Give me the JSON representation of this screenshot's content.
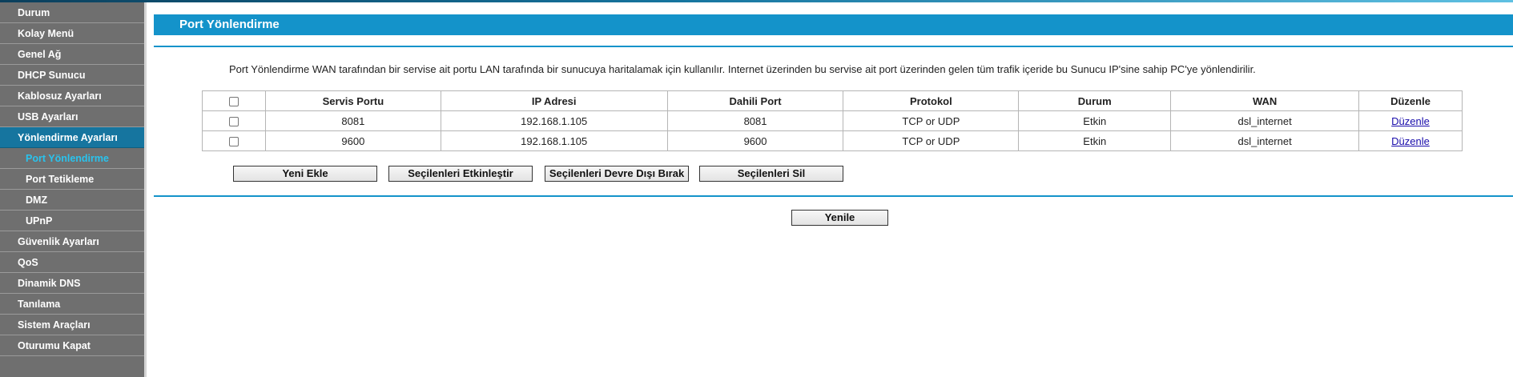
{
  "sidebar": {
    "items": [
      {
        "label": "Durum"
      },
      {
        "label": "Kolay Menü"
      },
      {
        "label": "Genel Ağ"
      },
      {
        "label": "DHCP Sunucu"
      },
      {
        "label": "Kablosuz Ayarları"
      },
      {
        "label": "USB Ayarları"
      },
      {
        "label": "Yönlendirme Ayarları"
      },
      {
        "label": "Port Yönlendirme"
      },
      {
        "label": "Port Tetikleme"
      },
      {
        "label": "DMZ"
      },
      {
        "label": "UPnP"
      },
      {
        "label": "Güvenlik Ayarları"
      },
      {
        "label": "QoS"
      },
      {
        "label": "Dinamik DNS"
      },
      {
        "label": "Tanılama"
      },
      {
        "label": "Sistem Araçları"
      },
      {
        "label": "Oturumu Kapat"
      }
    ]
  },
  "header": {
    "title": "Port Yönlendirme"
  },
  "description": "Port Yönlendirme WAN tarafından bir servise ait portu LAN tarafında bir sunucuya haritalamak için kullanılır. Internet üzerinden bu servise ait port üzerinden gelen tüm trafik içeride bu Sunucu IP'sine sahip PC'ye yönlendirilir.",
  "table": {
    "columns": [
      "Servis Portu",
      "IP Adresi",
      "Dahili Port",
      "Protokol",
      "Durum",
      "WAN",
      "Düzenle"
    ],
    "rows": [
      {
        "service_port": "8081",
        "ip": "192.168.1.105",
        "internal_port": "8081",
        "protocol": "TCP or UDP",
        "status": "Etkin",
        "wan": "dsl_internet",
        "edit": "Düzenle"
      },
      {
        "service_port": "9600",
        "ip": "192.168.1.105",
        "internal_port": "9600",
        "protocol": "TCP or UDP",
        "status": "Etkin",
        "wan": "dsl_internet",
        "edit": "Düzenle"
      }
    ]
  },
  "buttons": {
    "add": "Yeni Ekle",
    "enable": "Seçilenleri Etkinleştir",
    "disable": "Seçilenleri Devre Dışı Bırak",
    "delete": "Seçilenleri Sil",
    "refresh": "Yenile"
  }
}
